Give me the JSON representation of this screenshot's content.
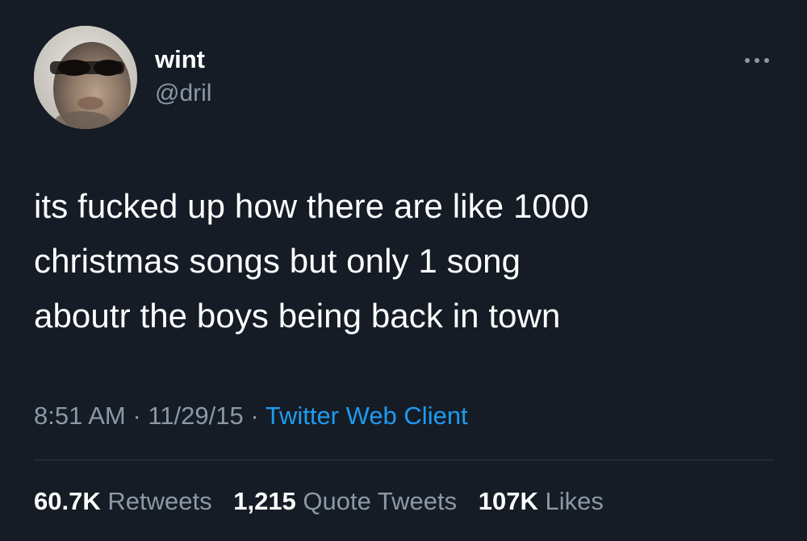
{
  "user": {
    "display_name": "wint",
    "handle": "@dril",
    "avatar_icon": "user-avatar"
  },
  "more_icon": "ellipsis-icon",
  "tweet": {
    "lines": [
      "its fucked up how there are like 1000",
      "christmas songs but only 1 song",
      "aboutr the boys being back in town"
    ]
  },
  "meta": {
    "time": "8:51 AM",
    "separator": "·",
    "date": "11/29/15",
    "client": "Twitter Web Client"
  },
  "stats": {
    "retweets": {
      "count": "60.7K",
      "label": "Retweets"
    },
    "quotes": {
      "count": "1,215",
      "label": "Quote Tweets"
    },
    "likes": {
      "count": "107K",
      "label": "Likes"
    }
  },
  "colors": {
    "background": "#151c26",
    "primary_text": "#ffffff",
    "secondary_text": "#8b98a5",
    "link": "#1d9bf0",
    "divider": "#2f3a46"
  }
}
